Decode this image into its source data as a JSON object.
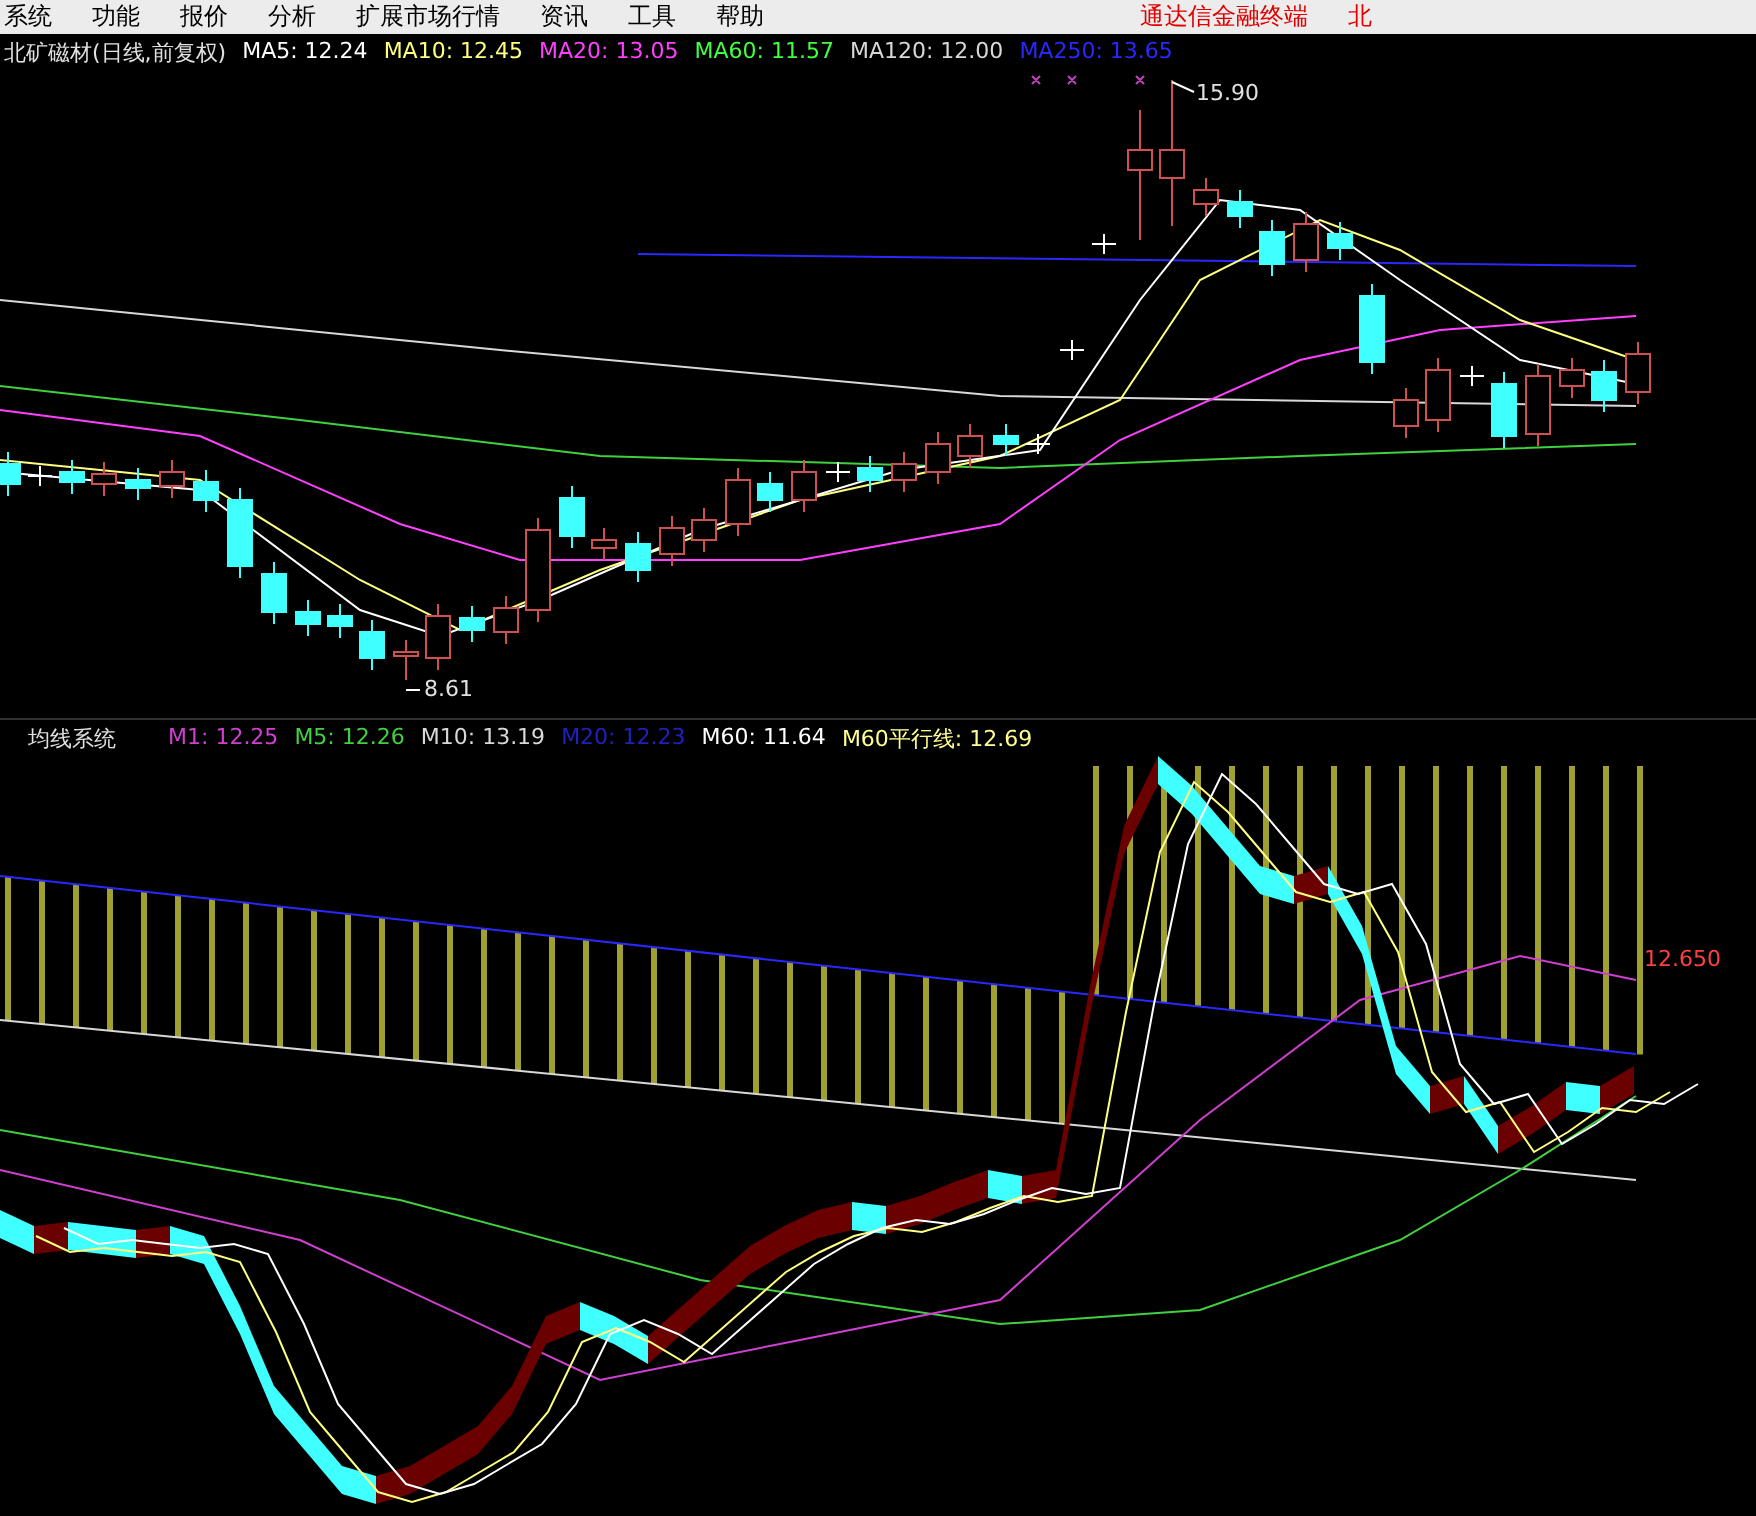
{
  "menu": {
    "items": [
      "系统",
      "功能",
      "报价",
      "分析",
      "扩展市场行情",
      "资讯",
      "工具",
      "帮助"
    ],
    "right_items": [
      "通达信金融终端",
      "北"
    ]
  },
  "main_chart": {
    "title": "北矿磁材(日线,前复权)",
    "indicators": [
      {
        "label": "MA5: 12.24",
        "color": "#ffffff"
      },
      {
        "label": "MA10: 12.45",
        "color": "#ffff80"
      },
      {
        "label": "MA20: 13.05",
        "color": "#ff40ff"
      },
      {
        "label": "MA60: 11.57",
        "color": "#40ff40"
      },
      {
        "label": "MA120: 12.00",
        "color": "#d8d8d8"
      },
      {
        "label": "MA250: 13.65",
        "color": "#2828ff"
      }
    ],
    "high_label": "15.90",
    "low_label": "8.61"
  },
  "sub_chart": {
    "title": "均线系统",
    "indicators": [
      {
        "label": "M1: 12.25",
        "color": "#d040d0"
      },
      {
        "label": "M5: 12.26",
        "color": "#40d040"
      },
      {
        "label": "M10: 13.19",
        "color": "#d8d8d8"
      },
      {
        "label": "M20: 12.23",
        "color": "#2020c0"
      },
      {
        "label": "M60: 11.64",
        "color": "#ffffff"
      },
      {
        "label": "M60平行线: 12.69",
        "color": "#ffff90"
      }
    ],
    "value_label": "12.650"
  }
}
